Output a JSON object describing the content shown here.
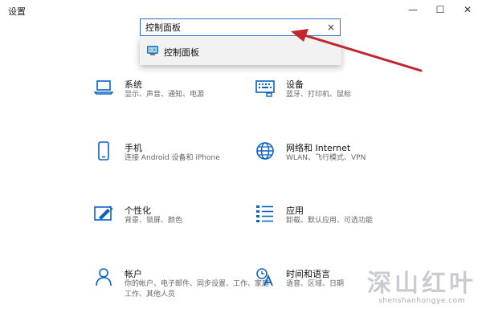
{
  "app": {
    "title": "设置"
  },
  "window_controls": {
    "minimize": "—",
    "maximize": "☐",
    "close": "✕"
  },
  "search": {
    "value": "控制面板",
    "clear": "×"
  },
  "suggestions": [
    {
      "label": "控制面板",
      "icon": "control-panel-icon"
    }
  ],
  "categories": [
    {
      "title": "系统",
      "subtitle": "显示、声音、通知、电源",
      "icon": "laptop-icon"
    },
    {
      "title": "设备",
      "subtitle": "蓝牙、打印机、鼠标",
      "icon": "keyboard-icon"
    },
    {
      "title": "手机",
      "subtitle": "连接 Android 设备和 iPhone",
      "icon": "phone-icon"
    },
    {
      "title": "网络和 Internet",
      "subtitle": "WLAN、飞行模式、VPN",
      "icon": "globe-icon"
    },
    {
      "title": "个性化",
      "subtitle": "背景、锁屏、颜色",
      "icon": "paint-icon"
    },
    {
      "title": "应用",
      "subtitle": "卸载、默认应用、可选功能",
      "icon": "apps-list-icon"
    },
    {
      "title": "帐户",
      "subtitle": "你的帐户、电子邮件、同步设置、工作、家庭",
      "subtitle2": "工作、其他人员",
      "icon": "person-icon"
    },
    {
      "title": "时间和语言",
      "subtitle": "语音、区域、日期",
      "icon": "time-language-icon"
    }
  ],
  "watermark": {
    "main": "深山红叶",
    "sub": "shenshanhongye.com"
  },
  "colors": {
    "accent": "#0a62c7",
    "annotation_arrow": "#c0282d",
    "search_border": "#2f6fc4"
  }
}
